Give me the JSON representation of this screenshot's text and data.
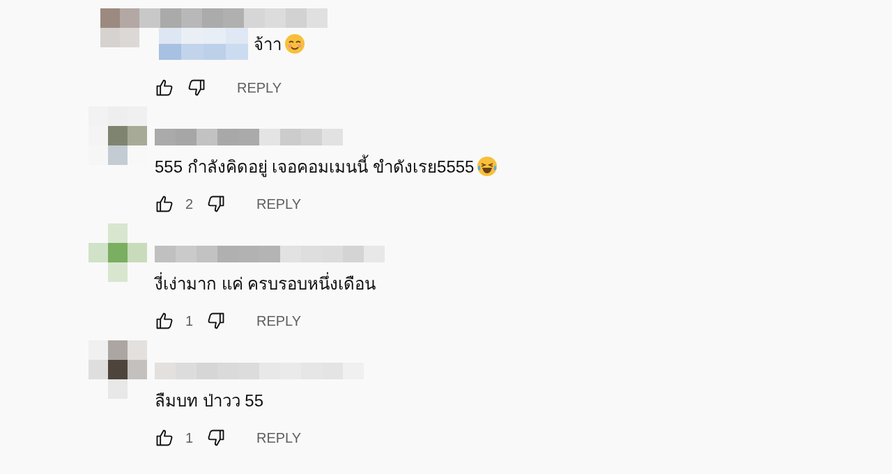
{
  "comments": [
    {
      "kind": "reply",
      "mention": true,
      "text": "จ้าา",
      "smiling_emoji": true,
      "reply_label": "REPLY"
    },
    {
      "kind": "comment",
      "text": "555 กำลังคิดอยู่ เจอคอมเมนนี้ ขำดังเรย5555",
      "laughing_emoji": true,
      "like_count": "2",
      "reply_label": "REPLY"
    },
    {
      "kind": "comment",
      "text": "งี่เง่ามาก แค่ ครบรอบหนึ่งเดือน",
      "like_count": "1",
      "reply_label": "REPLY"
    },
    {
      "kind": "comment",
      "text": "ลืมบท ป่าวว 55",
      "like_count": "1",
      "reply_label": "REPLY"
    }
  ]
}
